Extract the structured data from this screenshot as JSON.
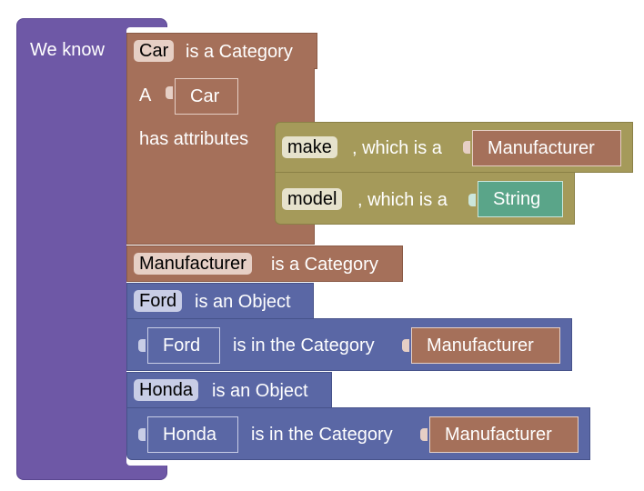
{
  "root": {
    "label": "We know"
  },
  "car_category": {
    "name": "Car",
    "suffix": "is a Category",
    "article": "A",
    "instance": "Car",
    "attributes_label": "has attributes",
    "attributes": [
      {
        "name": "make",
        "connector": ", which is a",
        "type": "Manufacturer"
      },
      {
        "name": "model",
        "connector": ", which is a",
        "type": "String"
      }
    ]
  },
  "manufacturer_category": {
    "name": "Manufacturer",
    "suffix": "is a Category"
  },
  "objects": [
    {
      "name": "Ford",
      "suffix": "is an Object",
      "relation": "is in the Category",
      "category": "Manufacturer"
    },
    {
      "name": "Honda",
      "suffix": "is an Object",
      "relation": "is in the Category",
      "category": "Manufacturer"
    }
  ],
  "colors": {
    "root": "#6e58a6",
    "category": "#a5705a",
    "attribute": "#a59a5a",
    "string_type": "#5aa589",
    "object": "#5a67a5"
  }
}
